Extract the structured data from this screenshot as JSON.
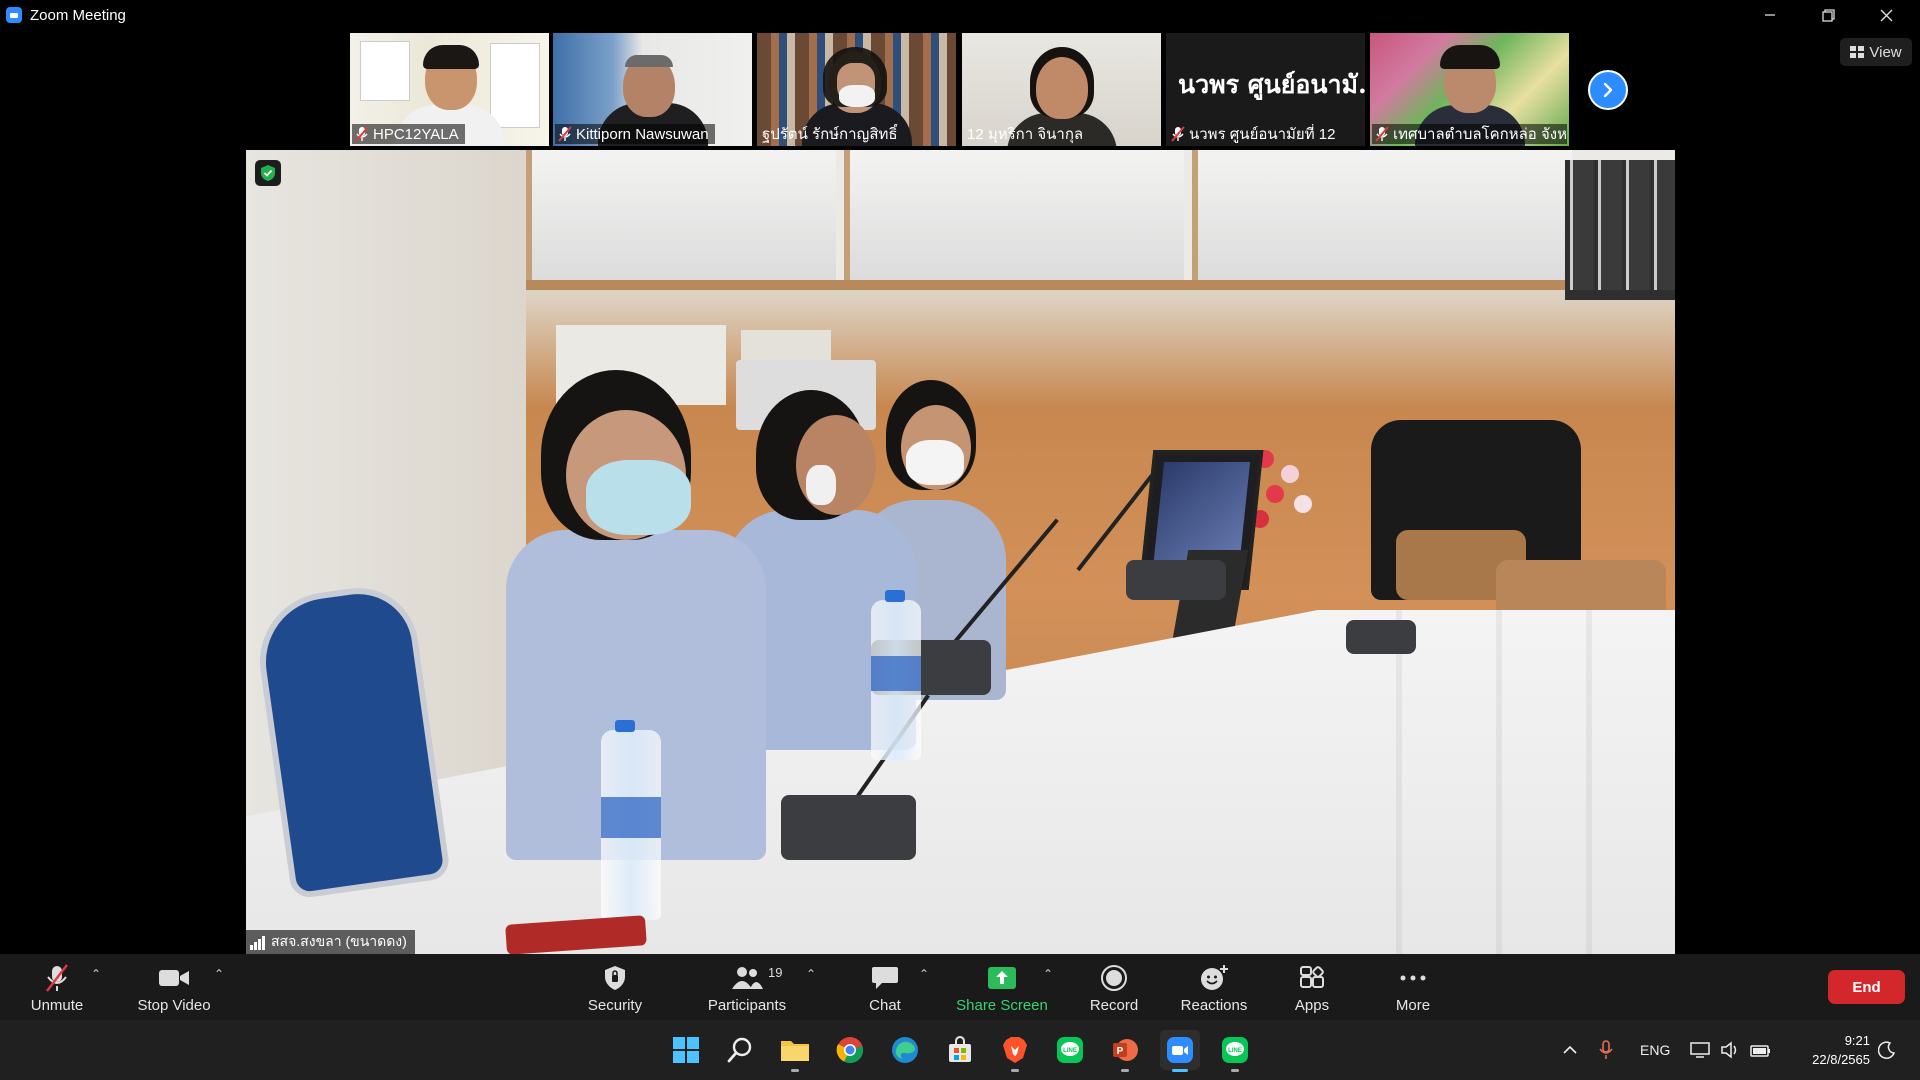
{
  "window": {
    "title": "Zoom Meeting"
  },
  "thumbnails": [
    {
      "name": "HPC12YALA",
      "muted": true
    },
    {
      "name": "Kittiporn Nawsuwan",
      "muted": true
    },
    {
      "name": "ฐปรัตน์ รักษ์กาญสิทธิ์",
      "muted": false
    },
    {
      "name": "12 มุหริกา จินากุล",
      "muted": false
    },
    {
      "name": "นวพร ศูนย์อนามัยที่ 12",
      "muted": true,
      "display_text": "นวพร ศูนย์อนามั..."
    },
    {
      "name": "เทศบาลตำบลโคกหล่อ จังห...",
      "muted": true
    }
  ],
  "view_button": {
    "label": "View"
  },
  "main_video": {
    "speaker_name": "สสจ.สงขลา (ขนาดดง)"
  },
  "toolbar": {
    "unmute": "Unmute",
    "stop_video": "Stop Video",
    "security": "Security",
    "participants": "Participants",
    "participants_count": "19",
    "chat": "Chat",
    "share_screen": "Share Screen",
    "record": "Record",
    "reactions": "Reactions",
    "apps": "Apps",
    "more": "More",
    "end": "End"
  },
  "taskbar": {
    "language": "ENG",
    "time": "9:21",
    "date": "22/8/2565",
    "apps": [
      "start-icon",
      "search-icon",
      "file-explorer-icon",
      "chrome-icon",
      "edge-icon",
      "store-icon",
      "brave-icon",
      "line-icon",
      "powerpoint-icon",
      "zoom-icon",
      "line-icon"
    ]
  },
  "colors": {
    "accent": "#2d8cff",
    "share_green": "#3bd170",
    "end_red": "#d3272c",
    "toolbar_bg": "#1a1a1a",
    "taskbar_bg": "#202020"
  }
}
